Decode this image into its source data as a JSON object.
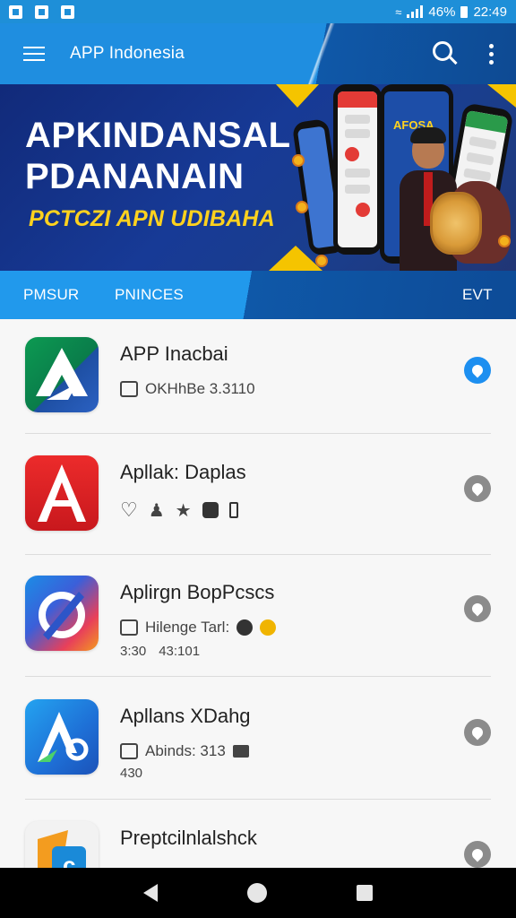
{
  "status_bar": {
    "battery": "46%",
    "time": "22:49"
  },
  "app_bar": {
    "title": "APP Indonesia"
  },
  "banner": {
    "title_line1": "APKINDANSAL",
    "title_line2": "PDANANAIN",
    "subtitle": "PCTCZI APN UDIBAHA",
    "phone_text": "AFOSA"
  },
  "tabs": {
    "left": "PMSUR",
    "middle": "PNINCES",
    "right": "EVT"
  },
  "apps": [
    {
      "name": "APP Inacbai",
      "meta": "OKHhBe 3.3110",
      "meta2": [],
      "action": "active",
      "icon_colors": [
        "#0a8a4a",
        "#1e4fa3"
      ]
    },
    {
      "name": "Apllak: Daplas",
      "meta": "",
      "meta2": [],
      "action": "inactive",
      "icon_colors": [
        "#e8262a",
        "#c2181c"
      ]
    },
    {
      "name": "Aplirgn BopPcscs",
      "meta": "Hilenge Tarl:",
      "meta2": [
        "3:30",
        "43:101"
      ],
      "action": "inactive",
      "icon_colors": [
        "#2a6fdc",
        "#ea3a5b"
      ]
    },
    {
      "name": "Apllans XDahg",
      "meta": "Abinds: 313",
      "meta2": [
        "430"
      ],
      "action": "inactive",
      "icon_colors": [
        "#1b8fe8",
        "#1f5bc4"
      ]
    },
    {
      "name": "Preptcilnlalshck",
      "meta": "",
      "meta2": [],
      "action": "inactive",
      "icon_colors": [
        "#f39c1f",
        "#1a8ad8"
      ]
    }
  ]
}
